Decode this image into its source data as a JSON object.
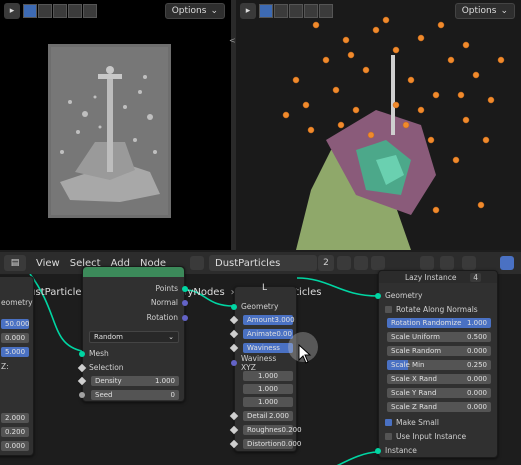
{
  "viewport_left": {
    "options_label": "Options"
  },
  "viewport_right": {
    "options_label": "Options"
  },
  "divider_glyph": "<>",
  "node_editor": {
    "menus": [
      "View",
      "Select",
      "Add",
      "Node"
    ],
    "node_tree_name": "DustParticles",
    "users_count": "2",
    "breadcrumb": [
      "DustParticles.001",
      "GeometryNodes",
      "DustParticles"
    ]
  },
  "left_partial_node": {
    "label": "eometry",
    "fields": [
      "50.000",
      "0.000",
      "5.000",
      "Z:",
      "2.000",
      "0.200",
      "0.000"
    ]
  },
  "distribute_node": {
    "outputs": [
      "Points",
      "Normal",
      "Rotation"
    ],
    "mode": "Random",
    "inputs": {
      "mesh": "Mesh",
      "selection": "Selection",
      "density_label": "Density",
      "density_value": "1.000",
      "seed_label": "Seed",
      "seed_value": "0"
    }
  },
  "noise_node": {
    "title": "L",
    "geometry": "Geometry",
    "amount_label": "Amount",
    "amount_value": "3.000",
    "animate_label": "Animate",
    "animate_value": "0.00",
    "waviness_label": "Waviness",
    "waviness_xyz_label": "Waviness XYZ",
    "xyz_values": [
      "1.000",
      "1.000",
      "1.000"
    ],
    "detail_label": "Detail",
    "detail_value": "2.000",
    "roughness_label": "Roughnes",
    "roughness_value": "0.200",
    "distortion_label": "Distortion",
    "distortion_value": "0.000"
  },
  "lazy_node": {
    "title": "Lazy Instance",
    "users": "4",
    "geometry": "Geometry",
    "rotate_along_normals": "Rotate Along Normals",
    "fields": [
      {
        "label": "Rotation Randomize",
        "value": "1.000",
        "blue": true
      },
      {
        "label": "Scale Uniform",
        "value": "0.500",
        "blue": false
      },
      {
        "label": "Scale Random",
        "value": "0.000",
        "blue": false
      },
      {
        "label": "Scale Min",
        "value": "0.250",
        "blue": true
      },
      {
        "label": "Scale X Rand",
        "value": "0.000",
        "blue": false
      },
      {
        "label": "Scale Y Rand",
        "value": "0.000",
        "blue": false
      },
      {
        "label": "Scale Z Rand",
        "value": "0.000",
        "blue": false
      }
    ],
    "make_small": "Make Small",
    "use_input_instance": "Use Input Instance",
    "instance": "Instance"
  },
  "colors": {
    "accent": "#4a71c3",
    "geometry_socket": "#00d6a3",
    "particles": "#f08a2c"
  }
}
